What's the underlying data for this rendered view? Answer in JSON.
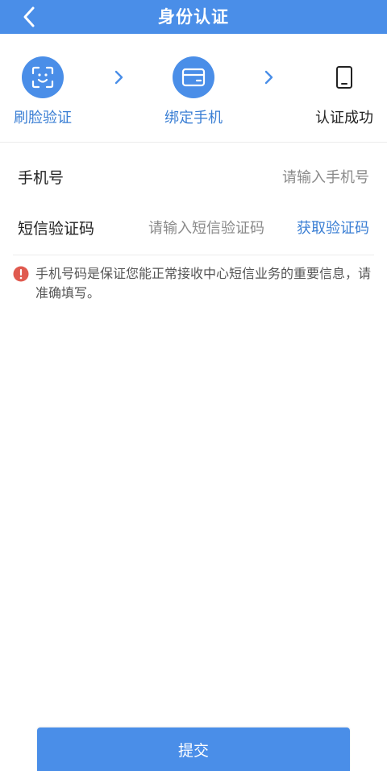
{
  "header": {
    "title": "身份认证",
    "back_icon": "chevron-left-icon",
    "color": "#4a8ee8"
  },
  "steps": [
    {
      "label": "刷脸验证",
      "icon": "face-scan-icon",
      "state": "active"
    },
    {
      "label": "绑定手机",
      "icon": "card-icon",
      "state": "active"
    },
    {
      "label": "认证成功",
      "icon": "phone-icon",
      "state": "pending"
    }
  ],
  "form": {
    "phone_label": "手机号",
    "phone_placeholder": "请输入手机号",
    "phone_value": "",
    "code_label": "短信验证码",
    "code_placeholder": "请输入短信验证码",
    "code_value": "",
    "get_code_label": "获取验证码"
  },
  "notice": {
    "icon": "exclamation-circle-icon",
    "text": "手机号码是保证您能正常接收中心短信业务的重要信息，请准确填写。"
  },
  "submit_label": "提交",
  "colors": {
    "accent": "#4a8ee8",
    "link": "#3b7fd4",
    "warning": "#e05a4f"
  }
}
